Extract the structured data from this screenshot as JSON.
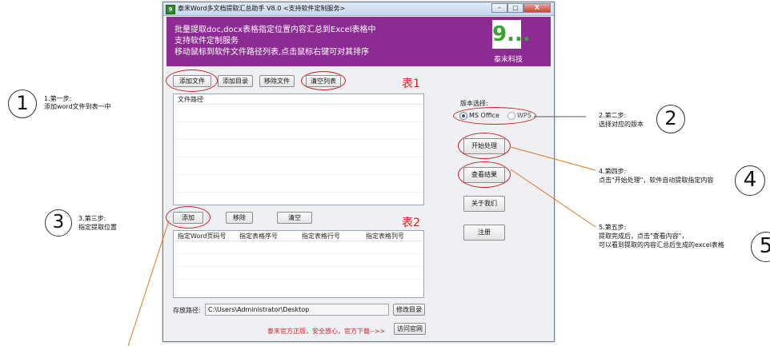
{
  "window": {
    "icon_glyph": "9",
    "title": "泰末Word多文档提取汇总助手 V8.0 <支持软件定制服务>",
    "controls": {
      "minimize": "–",
      "maximize": "□",
      "close": "X"
    }
  },
  "banner": {
    "lines": [
      "批量提取doc,docx表格指定位置内容汇总到Excel表格中",
      "支持软件定制服务",
      "移动鼠标到软件文件路径列表,点击鼠标右键可对其排序"
    ],
    "logo_glyph": "9...",
    "logo_text": "泰末科技"
  },
  "file_toolbar": {
    "add_file": "添加文件",
    "add_folder": "添加目录",
    "remove_file": "移除文件",
    "clear_list": "清空列表"
  },
  "table1": {
    "label": "表1",
    "column": "文件路径"
  },
  "position_toolbar": {
    "add": "添加",
    "remove": "移除",
    "clear": "清空"
  },
  "table2": {
    "label": "表2",
    "columns": [
      "指定Word页码号",
      "指定表格序号",
      "指定表格行号",
      "指定表格列号"
    ]
  },
  "version": {
    "label": "版本选择:",
    "options": [
      "MS Office",
      "WPS"
    ],
    "selected": "MS Office"
  },
  "side_buttons": {
    "start": "开始处理",
    "view_result": "查看结果",
    "about": "关于我们",
    "register": "注册"
  },
  "save_path": {
    "label": "存放路径:",
    "value": "C:\\Users\\Administrator\\Desktop",
    "change_button": "修改目录"
  },
  "footer": {
    "note": "泰末官方正版，安全放心，官方下载-->>",
    "visit_button": "访问官网"
  },
  "annotations": {
    "step1": {
      "number": "1",
      "title": "1.第一步:",
      "desc": "添加word文件到表一中"
    },
    "step2": {
      "number": "2",
      "title": "2.第二步:",
      "desc": "选择对应的版本"
    },
    "step3": {
      "number": "3",
      "title": "3.第三步:",
      "desc": "指定提取位置"
    },
    "step4": {
      "number": "4",
      "title": "4.第四步:",
      "desc": "点击\"开始处理\"，软件自动提取指定内容"
    },
    "step5": {
      "number": "5",
      "title": "5.第五步:",
      "desc1": "提取完成后，点击\"查看内容\"，",
      "desc2": "可以看到提取的内容汇总后生成的excel表格"
    }
  },
  "colors": {
    "banner": "#8e2a93",
    "highlight_red": "#cc1f1f",
    "leader_orange": "#e07820",
    "logo_green": "#39a12f"
  }
}
